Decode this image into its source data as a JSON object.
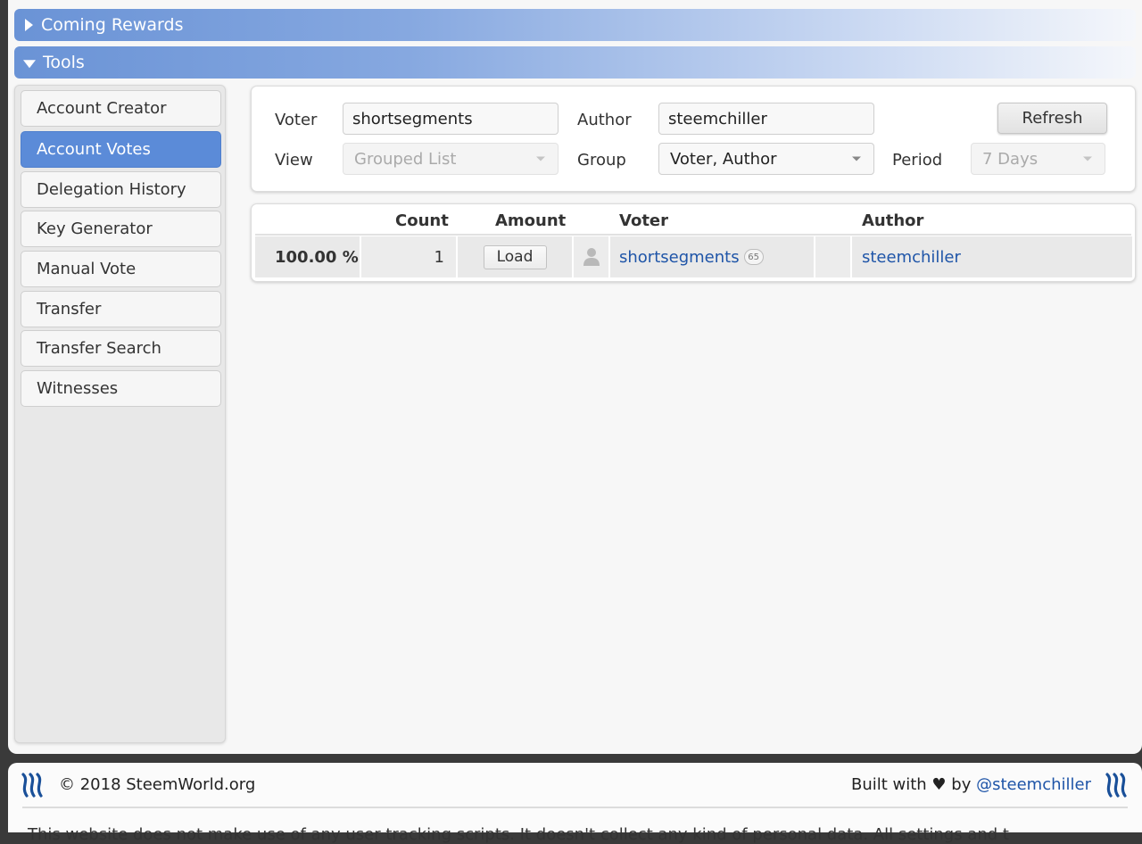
{
  "headers": {
    "coming_rewards": "Coming Rewards",
    "tools": "Tools"
  },
  "sidebar": {
    "items": [
      {
        "label": "Account Creator"
      },
      {
        "label": "Account Votes",
        "active": true
      },
      {
        "label": "Delegation History"
      },
      {
        "label": "Key Generator"
      },
      {
        "label": "Manual Vote"
      },
      {
        "label": "Transfer"
      },
      {
        "label": "Transfer Search"
      },
      {
        "label": "Witnesses"
      }
    ]
  },
  "filters": {
    "voter_label": "Voter",
    "voter_value": "shortsegments",
    "author_label": "Author",
    "author_value": "steemchiller",
    "view_label": "View",
    "view_value": "Grouped List",
    "group_label": "Group",
    "group_value": "Voter, Author",
    "period_label": "Period",
    "period_value": "7 Days",
    "refresh_label": "Refresh"
  },
  "table": {
    "columns": {
      "count": "Count",
      "amount": "Amount",
      "voter": "Voter",
      "author": "Author"
    },
    "rows": [
      {
        "percent": "100.00 %",
        "count": "1",
        "amount_button": "Load",
        "voter": "shortsegments",
        "voter_rep": "65",
        "author": "steemchiller"
      }
    ]
  },
  "footer": {
    "copyright": "© 2018 SteemWorld.org",
    "built_with": "Built with ♥ by ",
    "built_by": "@steemchiller",
    "disclaimer": "This website does not make use of any user tracking scripts. It doesn't collect any kind of personal data. All settings and t"
  },
  "colors": {
    "accent": "#5b8bd8",
    "link": "#1f55a8",
    "steem_icon": "#1a5099"
  }
}
